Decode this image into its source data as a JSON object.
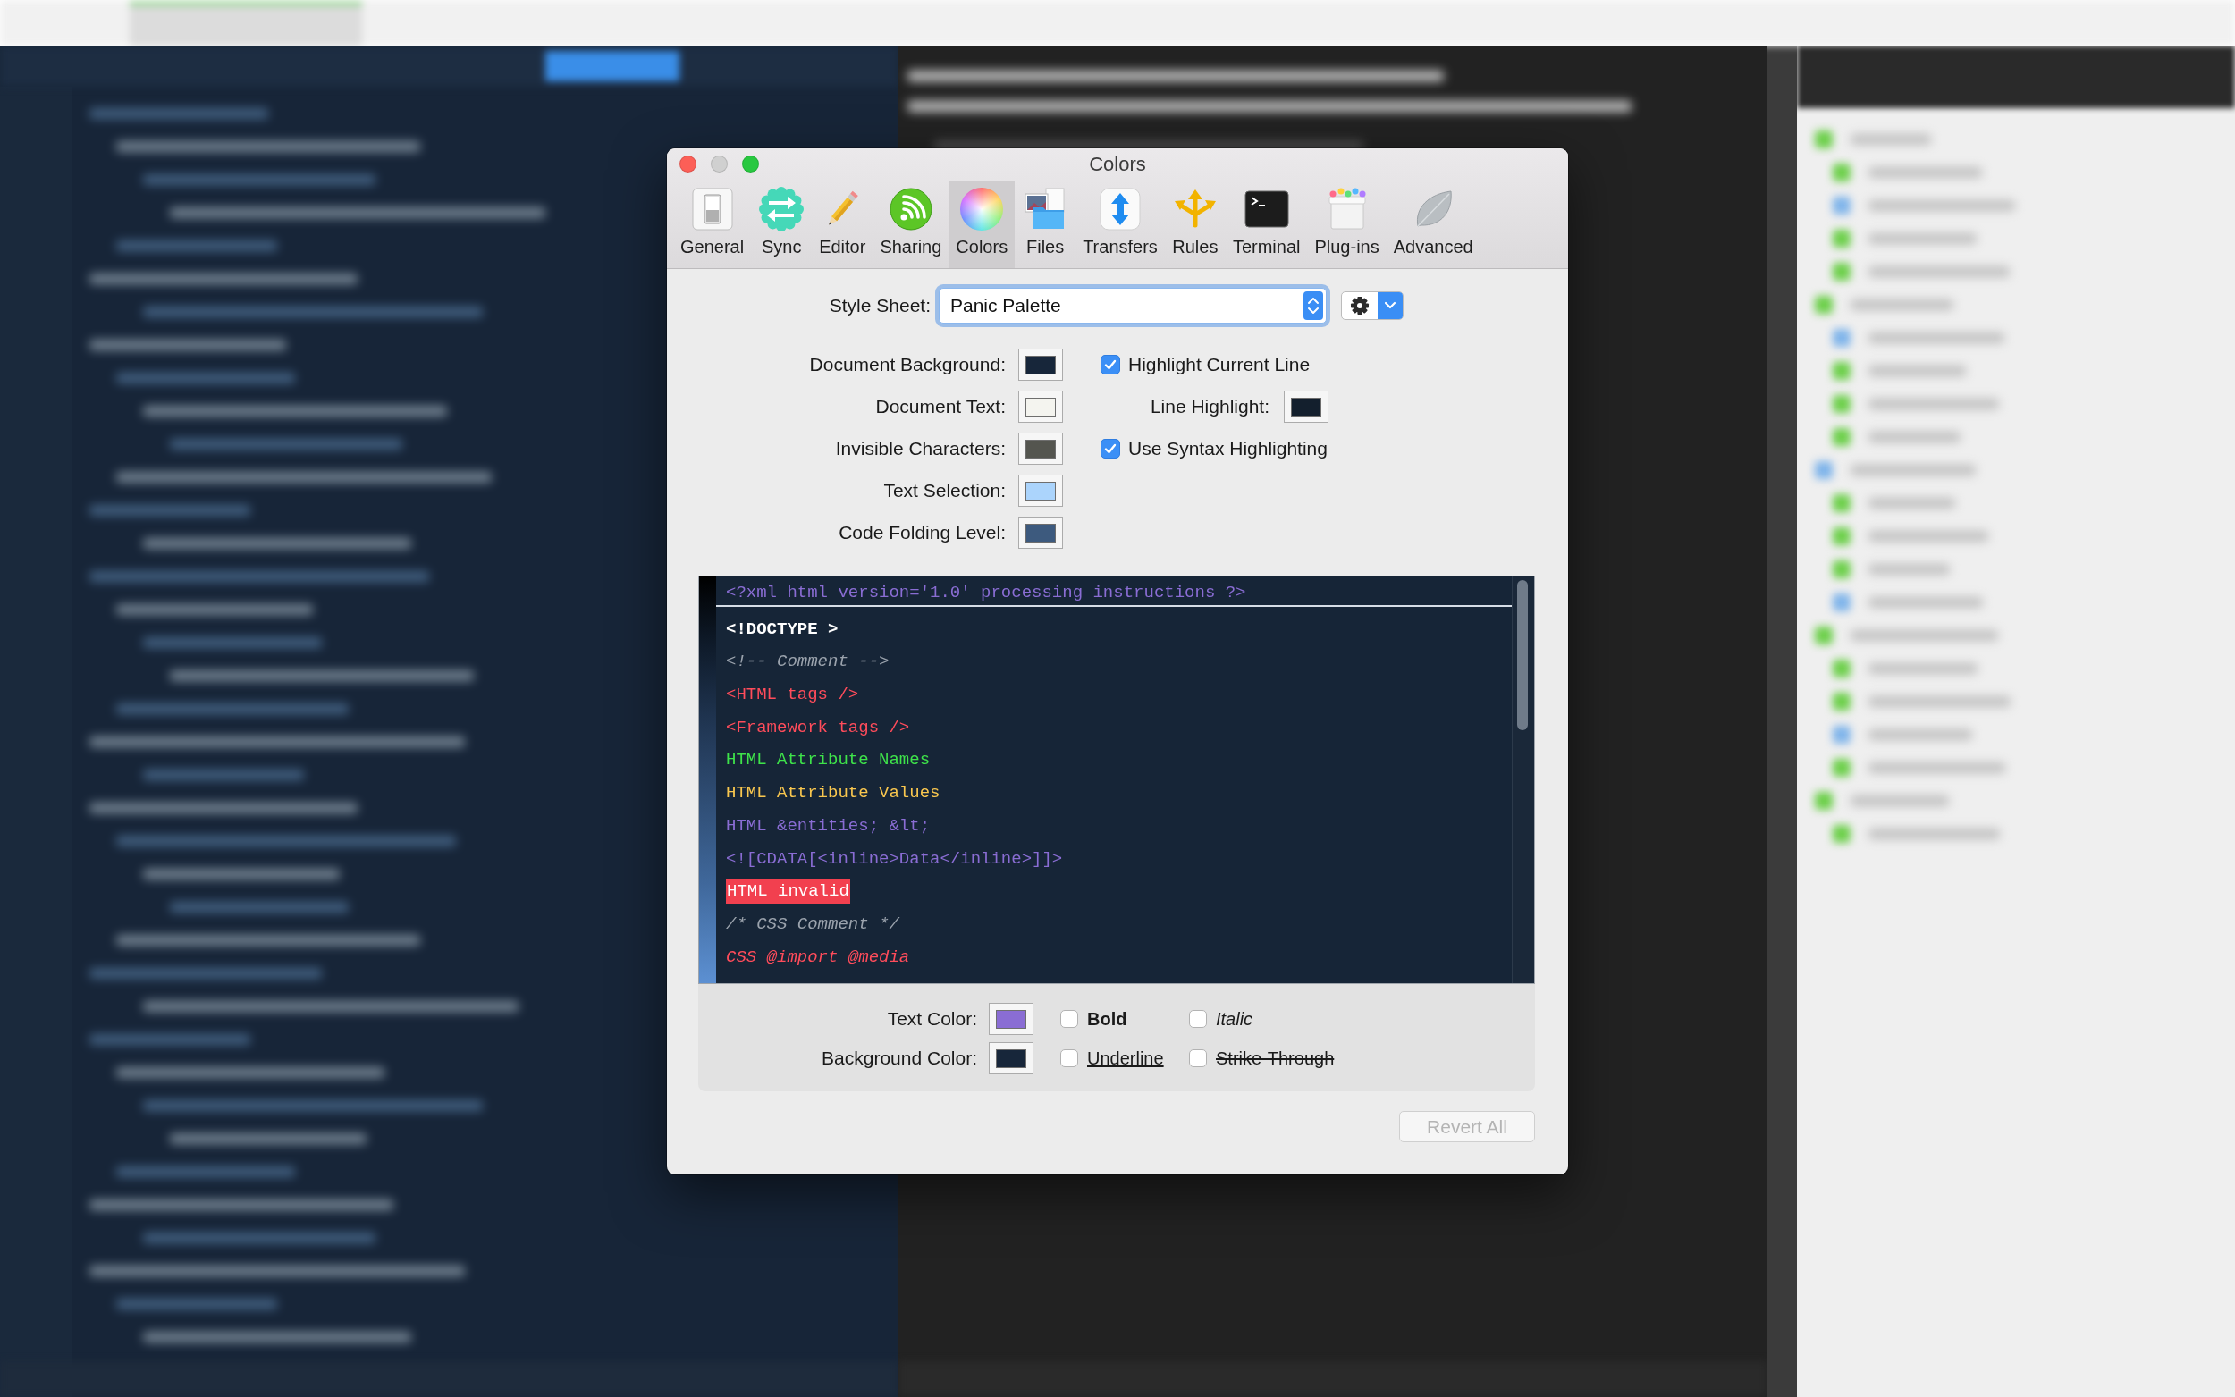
{
  "window": {
    "title": "Colors",
    "controls": [
      {
        "kind": "close",
        "disabled": false
      },
      {
        "kind": "minimize",
        "disabled": true
      },
      {
        "kind": "zoom",
        "disabled": false
      }
    ]
  },
  "toolbar": [
    {
      "label": "General",
      "selected": false
    },
    {
      "label": "Sync",
      "selected": false
    },
    {
      "label": "Editor",
      "selected": false
    },
    {
      "label": "Sharing",
      "selected": false
    },
    {
      "label": "Colors",
      "selected": true
    },
    {
      "label": "Files",
      "selected": false
    },
    {
      "label": "Transfers",
      "selected": false
    },
    {
      "label": "Rules",
      "selected": false
    },
    {
      "label": "Terminal",
      "selected": false
    },
    {
      "label": "Plug-ins",
      "selected": false
    },
    {
      "label": "Advanced",
      "selected": false
    }
  ],
  "style_sheet": {
    "label": "Style Sheet:",
    "value": "Panic Palette",
    "focused": true
  },
  "document_colors": [
    {
      "label": "Document Background:",
      "color": "#17263a"
    },
    {
      "label": "Document Text:",
      "color": "#f4f4ef"
    },
    {
      "label": "Invisible Characters:",
      "color": "#54554f"
    },
    {
      "label": "Text Selection:",
      "color": "#abd4fc"
    },
    {
      "label": "Code Folding Level:",
      "color": "#3d5a7e"
    }
  ],
  "options": [
    {
      "kind": "checkbox",
      "label": "Highlight Current Line",
      "checked": true
    },
    {
      "kind": "swatch",
      "label": "Line Highlight:",
      "color": "#131f2d"
    },
    {
      "kind": "checkbox",
      "label": "Use Syntax Highlighting",
      "checked": true
    }
  ],
  "preview": {
    "lines": [
      {
        "text": "<?xml html version='1.0' processing instructions ?>",
        "kind": "plain",
        "color": "#8a6dd4",
        "selected": true
      },
      {
        "text": "<!DOCTYPE >",
        "kind": "bold",
        "color": "#ffffff",
        "selected": false
      },
      {
        "text": "<!-- Comment -->",
        "kind": "italic",
        "color": "#9ba3ad",
        "selected": false
      },
      {
        "text": "<HTML tags />",
        "kind": "plain",
        "color": "#ff4c5b",
        "selected": false
      },
      {
        "text": "<Framework tags />",
        "kind": "plain",
        "color": "#ff4c5b",
        "selected": false
      },
      {
        "text": "HTML Attribute Names",
        "kind": "plain",
        "color": "#3ee34a",
        "selected": false
      },
      {
        "text": "HTML Attribute Values",
        "kind": "plain",
        "color": "#f9c74f",
        "selected": false
      },
      {
        "text": "HTML &entities; &lt;",
        "kind": "plain",
        "color": "#8a6dd4",
        "selected": false
      },
      {
        "text": "<![CDATA[<inline>Data</inline>]]>",
        "kind": "plain",
        "color": "#8a6dd4",
        "selected": false
      },
      {
        "text": "HTML invalid",
        "kind": "marked",
        "color": "#f2404f",
        "selected": false
      },
      {
        "text": "/* CSS Comment */",
        "kind": "italic",
        "color": "#9ba3ad",
        "selected": false
      },
      {
        "text": "CSS @import @media",
        "kind": "italic",
        "color": "#ff4c5b",
        "selected": false
      }
    ]
  },
  "text_attributes": {
    "swatches": [
      {
        "label": "Text Color:",
        "color": "#8a6dd4"
      },
      {
        "label": "Background Color:",
        "color": "#17263a"
      }
    ],
    "styles": [
      {
        "label": "Bold",
        "kind": "bold",
        "checked": false
      },
      {
        "label": "Italic",
        "kind": "italic",
        "checked": false
      },
      {
        "label": "Underline",
        "kind": "underline",
        "checked": false
      },
      {
        "label": "Strike-Through",
        "kind": "strike",
        "checked": false
      }
    ]
  },
  "revert_button": {
    "label": "Revert All",
    "disabled": true
  }
}
